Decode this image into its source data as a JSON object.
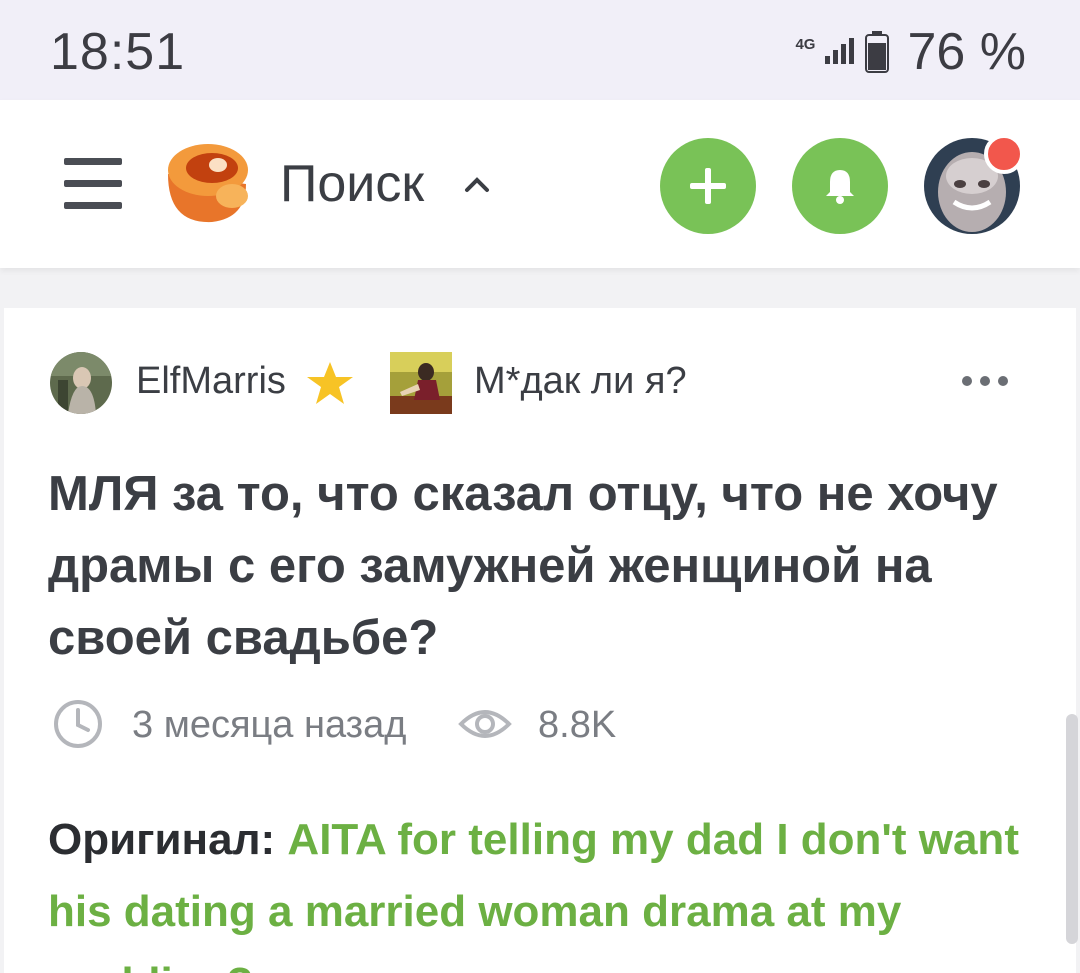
{
  "status_bar": {
    "time": "18:51",
    "network": "4G",
    "battery": "76 %",
    "battery_level": 0.76
  },
  "app_bar": {
    "search_label": "Поиск",
    "icons": [
      "menu-icon",
      "logo-icon",
      "chevron-up-icon",
      "plus-icon",
      "bell-icon",
      "avatar"
    ],
    "accent_color": "#79c257",
    "notification_dot_color": "#f2574c"
  },
  "post": {
    "author": "ElfMarris",
    "community": "М*дак ли я?",
    "title": "МЛЯ за то, что сказал отцу, что не хочу драмы с его замужней женщиной на своей свадьбе?",
    "time_ago": "3 месяца назад",
    "views": "8.8K",
    "original_label": "Оригинал:",
    "original_link": "AITA for telling my dad I don't want his dating a married woman drama at my wedding?",
    "link_color": "#6cb043"
  }
}
